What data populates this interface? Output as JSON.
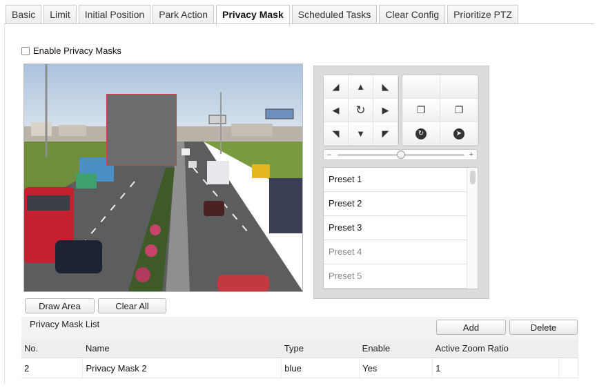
{
  "tabs": [
    {
      "label": "Basic",
      "active": false
    },
    {
      "label": "Limit",
      "active": false
    },
    {
      "label": "Initial Position",
      "active": false
    },
    {
      "label": "Park Action",
      "active": false
    },
    {
      "label": "Privacy Mask",
      "active": true
    },
    {
      "label": "Scheduled Tasks",
      "active": false
    },
    {
      "label": "Clear Config",
      "active": false
    },
    {
      "label": "Prioritize PTZ",
      "active": false
    }
  ],
  "enable_privacy_masks": {
    "label": "Enable Privacy Masks",
    "checked": false
  },
  "video_controls": {
    "draw_area": "Draw Area",
    "clear_all": "Clear All"
  },
  "ptz": {
    "direction_icons": [
      "arrow-up-left",
      "arrow-up",
      "arrow-up-right",
      "arrow-left",
      "auto-rotate",
      "arrow-right",
      "arrow-down-left",
      "arrow-down",
      "arrow-down-right"
    ],
    "function_icons": [
      "blank",
      "blank",
      "zoom-in",
      "zoom-out",
      "focus-near",
      "focus-far"
    ],
    "speed_level": 0.5,
    "presets": [
      {
        "label": "Preset 1",
        "dim": false
      },
      {
        "label": "Preset 2",
        "dim": false
      },
      {
        "label": "Preset 3",
        "dim": false
      },
      {
        "label": "Preset 4",
        "dim": true
      },
      {
        "label": "Preset 5",
        "dim": true
      }
    ]
  },
  "mask_list": {
    "title": "Privacy Mask List",
    "add_label": "Add",
    "delete_label": "Delete",
    "columns": [
      "No.",
      "Name",
      "Type",
      "Enable",
      "Active Zoom Ratio"
    ],
    "rows": [
      [
        "2",
        "Privacy Mask 2",
        "blue",
        "Yes",
        "1"
      ]
    ]
  }
}
